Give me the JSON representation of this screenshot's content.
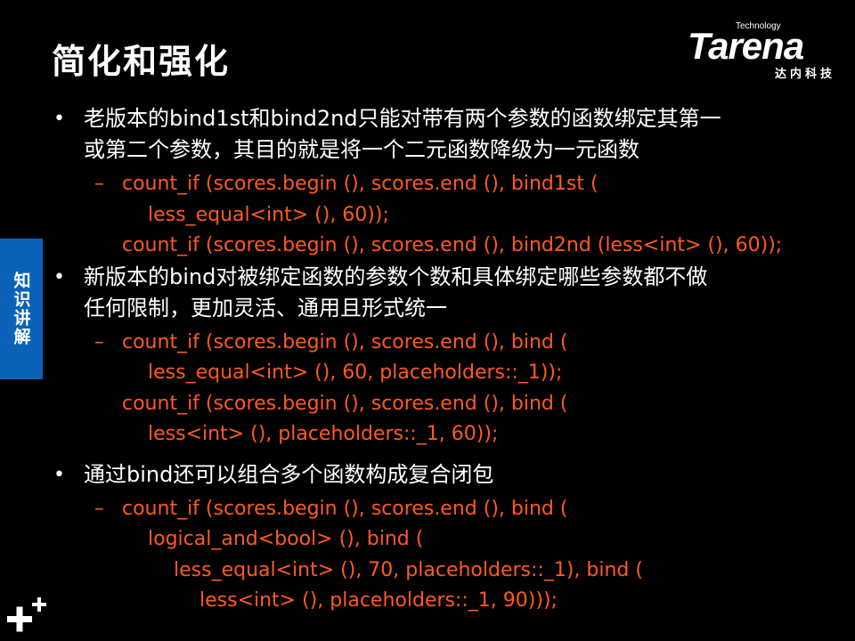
{
  "slide": {
    "title": "简化和强化",
    "logo": {
      "brand": "Tarena",
      "tagline": "Technology",
      "cn": "达内科技"
    },
    "side_tab": "知识讲解",
    "bullets": [
      {
        "text_lines": [
          "老版本的bind1st和bind2nd只能对带有两个参数的函数绑定其第一",
          "或第二个参数，其目的就是将一个二元函数降级为一元函数"
        ],
        "code": [
          "count_if (scores.begin (), scores.end (), bind1st (",
          "less_equal<int> (), 60));",
          "count_if (scores.begin (), scores.end (), bind2nd (less<int> (), 60));"
        ]
      },
      {
        "text_lines": [
          "新版本的bind对被绑定函数的参数个数和具体绑定哪些参数都不做",
          "任何限制，更加灵活、通用且形式统一"
        ],
        "code": [
          "count_if (scores.begin (), scores.end (), bind (",
          "less_equal<int> (), 60, placeholders::_1));",
          "count_if (scores.begin (), scores.end (), bind (",
          "less<int> (), placeholders::_1, 60));"
        ]
      },
      {
        "text_lines": [
          "通过bind还可以组合多个函数构成复合闭包"
        ],
        "code": [
          "count_if (scores.begin (), scores.end (), bind (",
          "logical_and<bool> (), bind (",
          "less_equal<int> (), 70, placeholders::_1), bind (",
          "less<int> (), placeholders::_1, 90)));"
        ]
      }
    ],
    "colors": {
      "background": "#000000",
      "text": "#ffffff",
      "code": "#ff5a1e",
      "side_tab": "#0a63b8"
    }
  }
}
